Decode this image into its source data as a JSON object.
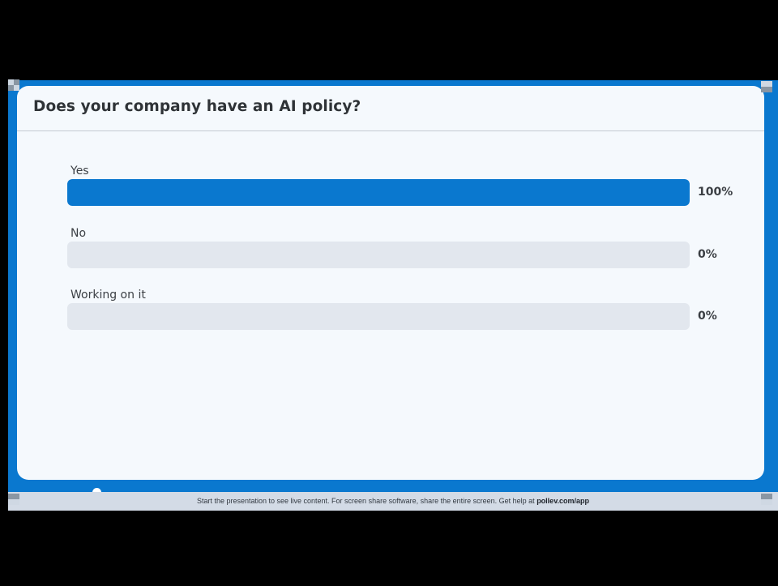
{
  "poll": {
    "question": "Does your company have an AI policy?",
    "options": [
      {
        "label": "Yes",
        "percent_label": "100%",
        "fraction": 1.0
      },
      {
        "label": "No",
        "percent_label": "0%",
        "fraction": 0.0
      },
      {
        "label": "Working on it",
        "percent_label": "0%",
        "fraction": 0.0
      }
    ]
  },
  "footer": {
    "message": "Start the presentation to see live content. For screen share software, share the entire screen. Get help at ",
    "link": "pollev.com/app"
  },
  "colors": {
    "accent": "#0a78cf",
    "track": "#e2e7ee",
    "card_background": "#f5f9fd",
    "page_background": "#000000",
    "footer_background": "#d3dbe6"
  }
}
